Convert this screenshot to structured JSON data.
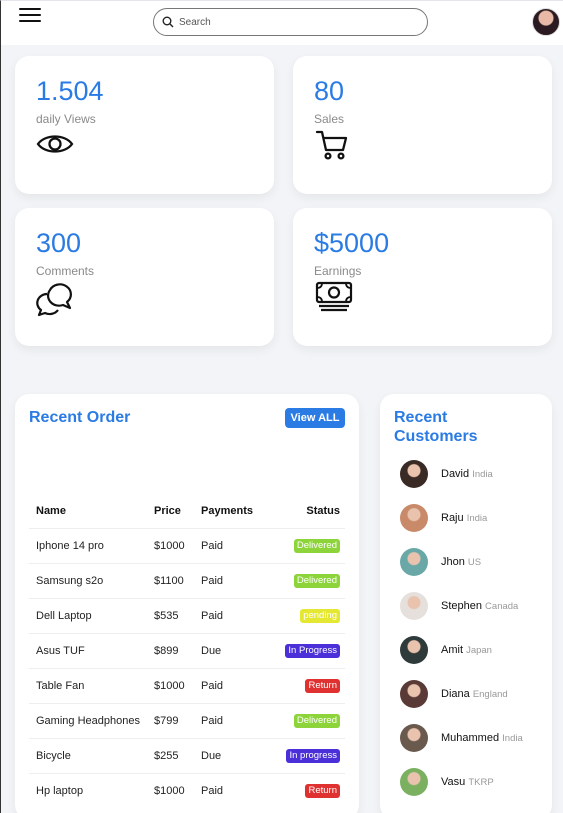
{
  "search": {
    "placeholder": "Search"
  },
  "stats": [
    {
      "value": "1.504",
      "label": "daily Views",
      "icon": "eye-icon"
    },
    {
      "value": "80",
      "label": "Sales",
      "icon": "cart-icon"
    },
    {
      "value": "300",
      "label": "Comments",
      "icon": "chat-icon"
    },
    {
      "value": "$5000",
      "label": "Earnings",
      "icon": "money-icon"
    }
  ],
  "orders": {
    "title": "Recent Order",
    "view_all": "View ALL",
    "headers": [
      "Name",
      "Price",
      "Payments",
      "Status"
    ],
    "rows": [
      {
        "name": "Iphone 14 pro",
        "price": "$1000",
        "payment": "Paid",
        "status": "Delivered",
        "status_color": "#8cd43a"
      },
      {
        "name": "Samsung s2o",
        "price": "$1100",
        "payment": "Paid",
        "status": "Delivered",
        "status_color": "#8cd43a"
      },
      {
        "name": "Dell Laptop",
        "price": "$535",
        "payment": "Paid",
        "status": "pending",
        "status_color": "#e4e832"
      },
      {
        "name": "Asus TUF",
        "price": "$899",
        "payment": "Due",
        "status": "In Progress",
        "status_color": "#4b2fd9"
      },
      {
        "name": "Table Fan",
        "price": "$1000",
        "payment": "Paid",
        "status": "Return",
        "status_color": "#e03131"
      },
      {
        "name": "Gaming Headphones",
        "price": "$799",
        "payment": "Paid",
        "status": "Delivered",
        "status_color": "#8cd43a"
      },
      {
        "name": "Bicycle",
        "price": "$255",
        "payment": "Due",
        "status": "In progress",
        "status_color": "#4b2fd9"
      },
      {
        "name": "Hp laptop",
        "price": "$1000",
        "payment": "Paid",
        "status": "Return",
        "status_color": "#e03131"
      }
    ]
  },
  "customers": {
    "title_line1": "Recent",
    "title_line2": "Customers",
    "list": [
      {
        "name": "David",
        "country": "India",
        "avatar_color": "#3a2a26"
      },
      {
        "name": "Raju",
        "country": "India",
        "avatar_color": "#c98a6a"
      },
      {
        "name": "Jhon",
        "country": "US",
        "avatar_color": "#6aa8a8"
      },
      {
        "name": "Stephen",
        "country": "Canada",
        "avatar_color": "#e6e0dc"
      },
      {
        "name": "Amit",
        "country": "Japan",
        "avatar_color": "#2f3a3a"
      },
      {
        "name": "Diana",
        "country": "England",
        "avatar_color": "#5a3a36"
      },
      {
        "name": "Muhammed",
        "country": "India",
        "avatar_color": "#6a5a4e"
      },
      {
        "name": "Vasu",
        "country": "TKRP",
        "avatar_color": "#7ab060"
      }
    ]
  },
  "colors": {
    "accent": "#2a7be4",
    "background": "#f2f4f7"
  }
}
